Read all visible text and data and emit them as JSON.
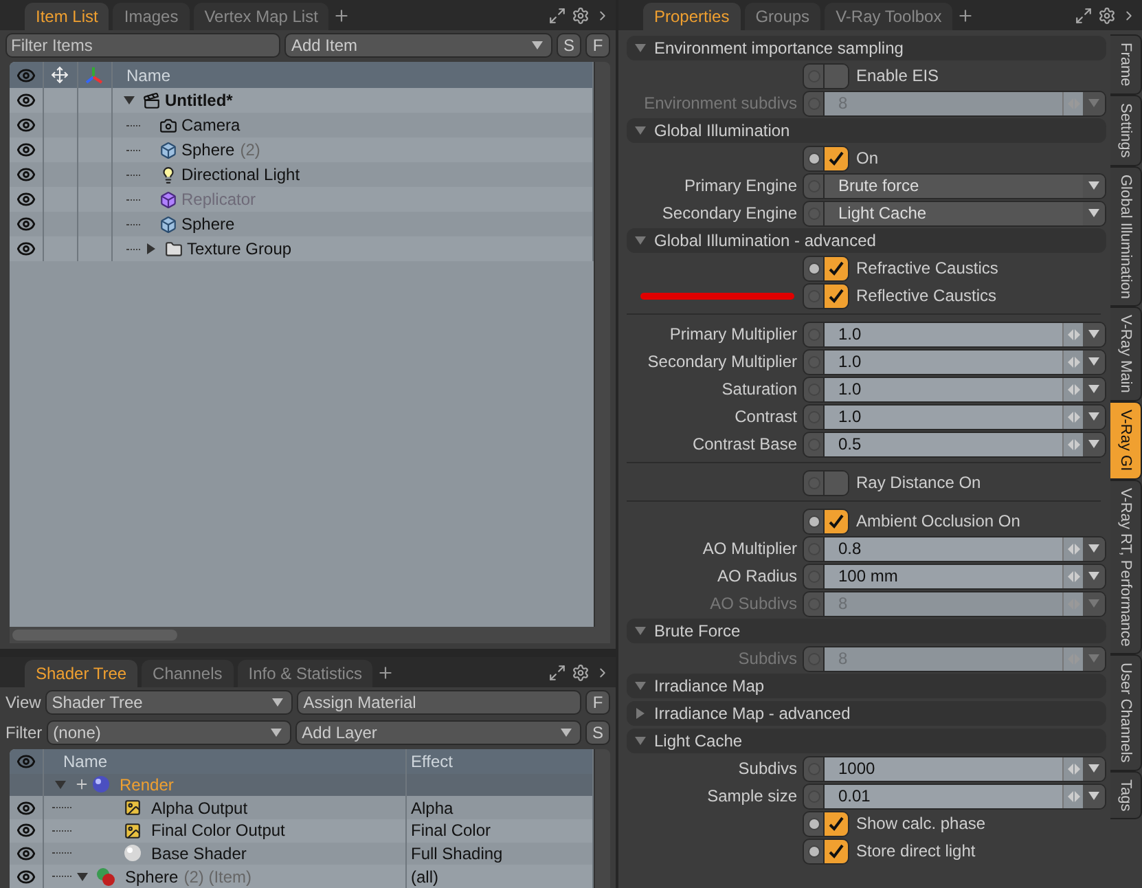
{
  "item_list_panel": {
    "tabs": [
      {
        "label": "Item List",
        "selected": true
      },
      {
        "label": "Images",
        "selected": false
      },
      {
        "label": "Vertex Map List",
        "selected": false
      }
    ],
    "filter": {
      "placeholder": "Filter Items"
    },
    "add_item": "Add Item",
    "buttons": [
      "S",
      "F"
    ],
    "columns": [
      "Name"
    ],
    "items": [
      {
        "name": "Untitled*",
        "kind": "scene",
        "expanded": true,
        "disabled": false,
        "children": [
          {
            "name": "Camera",
            "kind": "camera",
            "disabled": false
          },
          {
            "name": "Sphere",
            "count": "(2)",
            "kind": "mesh",
            "disabled": false
          },
          {
            "name": "Directional Light",
            "kind": "light",
            "disabled": false
          },
          {
            "name": "Replicator",
            "kind": "replicator",
            "disabled": true
          },
          {
            "name": "Sphere",
            "kind": "mesh",
            "disabled": false
          },
          {
            "name": "Texture Group",
            "kind": "group",
            "expanded": false,
            "disabled": false
          }
        ]
      }
    ]
  },
  "shader_tree_panel": {
    "tabs": [
      {
        "label": "Shader Tree",
        "selected": true
      },
      {
        "label": "Channels",
        "selected": false
      },
      {
        "label": "Info & Statistics",
        "selected": false
      }
    ],
    "view": {
      "label": "View",
      "value": "Shader Tree"
    },
    "assign_button": "Assign Material",
    "f_button": "F",
    "filter": {
      "label": "Filter",
      "value": "(none)"
    },
    "add_layer": "Add Layer",
    "s_button": "S",
    "columns": [
      "Name",
      "Effect"
    ],
    "rows": [
      {
        "name": "Render",
        "kind": "render",
        "visible": false,
        "expanded": true,
        "children": [
          {
            "name": "Alpha Output",
            "kind": "output",
            "visible": true,
            "effect": "Alpha"
          },
          {
            "name": "Final Color Output",
            "kind": "output",
            "visible": true,
            "effect": "Final Color"
          },
          {
            "name": "Base Shader",
            "kind": "shader",
            "visible": true,
            "effect": "Full Shading"
          },
          {
            "name": "Sphere",
            "suffix": "(2) (Item)",
            "kind": "material",
            "visible": true,
            "expanded": true,
            "effect": "(all)"
          }
        ]
      }
    ]
  },
  "properties_panel": {
    "tabs": [
      {
        "label": "Properties",
        "selected": true
      },
      {
        "label": "Groups",
        "selected": false
      },
      {
        "label": "V-Ray Toolbox",
        "selected": false
      }
    ],
    "rows": [
      {
        "kind": "section",
        "label": "Environment importance sampling",
        "expanded": true
      },
      {
        "kind": "toggle",
        "label": "Enable EIS",
        "checked": false,
        "marked": false
      },
      {
        "kind": "number",
        "label": "Environment subdivs",
        "value": "8",
        "disabled": true
      },
      {
        "kind": "section",
        "label": "Global Illumination",
        "expanded": true
      },
      {
        "kind": "toggle",
        "label": "On",
        "checked": true,
        "marked": false
      },
      {
        "kind": "dropdown",
        "label": "Primary Engine",
        "value": "Brute force"
      },
      {
        "kind": "dropdown",
        "label": "Secondary Engine",
        "value": "Light Cache"
      },
      {
        "kind": "section",
        "label": "Global Illumination - advanced",
        "expanded": true
      },
      {
        "kind": "toggle",
        "label": "Refractive Caustics",
        "checked": true,
        "marked": false
      },
      {
        "kind": "toggle",
        "label": "Reflective Caustics",
        "checked": true,
        "marked": true
      },
      {
        "kind": "divider"
      },
      {
        "kind": "number",
        "label": "Primary Multiplier",
        "value": "1.0",
        "disabled": false
      },
      {
        "kind": "number",
        "label": "Secondary Multiplier",
        "value": "1.0",
        "disabled": false
      },
      {
        "kind": "number",
        "label": "Saturation",
        "value": "1.0",
        "disabled": false
      },
      {
        "kind": "number",
        "label": "Contrast",
        "value": "1.0",
        "disabled": false
      },
      {
        "kind": "number",
        "label": "Contrast Base",
        "value": "0.5",
        "disabled": false
      },
      {
        "kind": "divider"
      },
      {
        "kind": "toggle",
        "label": "Ray Distance On",
        "checked": false,
        "marked": false
      },
      {
        "kind": "divider"
      },
      {
        "kind": "toggle",
        "label": "Ambient Occlusion On",
        "checked": true,
        "marked": false
      },
      {
        "kind": "number",
        "label": "AO Multiplier",
        "value": "0.8",
        "disabled": false
      },
      {
        "kind": "number",
        "label": "AO Radius",
        "value": "100 mm",
        "disabled": false
      },
      {
        "kind": "number",
        "label": "AO Subdivs",
        "value": "8",
        "disabled": true
      },
      {
        "kind": "section",
        "label": "Brute Force",
        "expanded": true
      },
      {
        "kind": "number",
        "label": "Subdivs",
        "value": "8",
        "disabled": true
      },
      {
        "kind": "section",
        "label": "Irradiance Map",
        "expanded": true
      },
      {
        "kind": "section",
        "label": "Irradiance Map - advanced",
        "expanded": false
      },
      {
        "kind": "section",
        "label": "Light Cache",
        "expanded": true
      },
      {
        "kind": "number",
        "label": "Subdivs",
        "value": "1000",
        "disabled": false
      },
      {
        "kind": "number",
        "label": "Sample size",
        "value": "0.01",
        "disabled": false
      },
      {
        "kind": "toggle",
        "label": "Show calc. phase",
        "checked": true,
        "marked": false
      },
      {
        "kind": "toggle",
        "label": "Store direct light",
        "checked": true,
        "marked": false
      }
    ],
    "side_tabs": [
      {
        "label": "Frame",
        "selected": false
      },
      {
        "label": "Settings",
        "selected": false
      },
      {
        "label": "Global Illumination",
        "selected": false
      },
      {
        "label": "V-Ray Main",
        "selected": false
      },
      {
        "label": "V-Ray GI",
        "selected": true
      },
      {
        "label": "V-Ray RT, Performance",
        "selected": false
      },
      {
        "label": "User Channels",
        "selected": false
      },
      {
        "label": "Tags",
        "selected": false
      }
    ]
  }
}
